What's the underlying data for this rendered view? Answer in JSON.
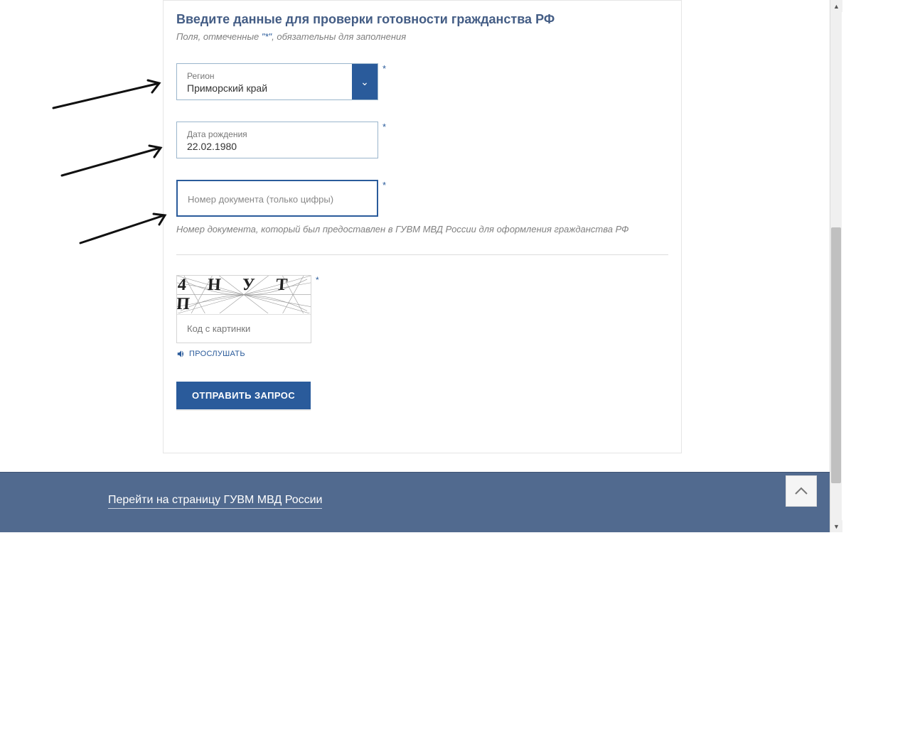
{
  "form": {
    "title": "Введите данные для проверки готовности гражданства РФ",
    "subtitle_pre": "Поля, отмеченные ",
    "subtitle_mark": "\"*\"",
    "subtitle_post": ", обязательны для заполнения",
    "region": {
      "label": "Регион",
      "value": "Приморский край"
    },
    "dob": {
      "label": "Дата рождения",
      "value": "22.02.1980"
    },
    "doc": {
      "label": "Номер документа (только цифры)",
      "value": ""
    },
    "doc_help": "Номер документа, который был предоставлен в ГУВМ МВД России для оформления гражданства РФ",
    "captcha": {
      "glyphs": "4 Н У Т П",
      "label": "Код с картинки"
    },
    "listen_label": "ПРОСЛУШАТЬ",
    "submit_label": "ОТПРАВИТЬ ЗАПРОС"
  },
  "footer": {
    "link": "Перейти на страницу ГУВМ МВД России"
  }
}
